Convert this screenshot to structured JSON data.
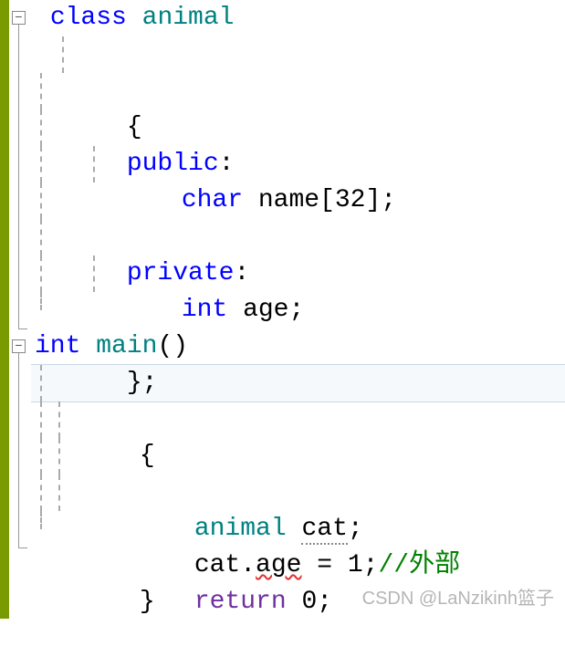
{
  "code": {
    "line1_kw_class": "class",
    "line1_name": "animal",
    "line2_brace": "{",
    "line3_kw_public": "public",
    "line3_colon": ":",
    "line4_kw_char": "char",
    "line4_decl": "name[32];",
    "line6_kw_private": "private",
    "line6_colon": ":",
    "line7_kw_int": "int",
    "line7_decl": "age;",
    "line9_close": "};",
    "line10_kw_int": "int",
    "line10_name": "main",
    "line10_parens": "()",
    "line11_brace": "{",
    "line12_type": "animal",
    "line12_var": "cat",
    "line12_semi": ";",
    "line13_obj": "cat.",
    "line13_member": "age",
    "line13_assign": " = 1;",
    "line13_comment": "//外部",
    "line14_kw_return": "return",
    "line14_val": "0;",
    "line15_close": "}"
  },
  "fold_symbols": {
    "minus": "−"
  },
  "watermark": "CSDN @LaNzikinh篮子"
}
